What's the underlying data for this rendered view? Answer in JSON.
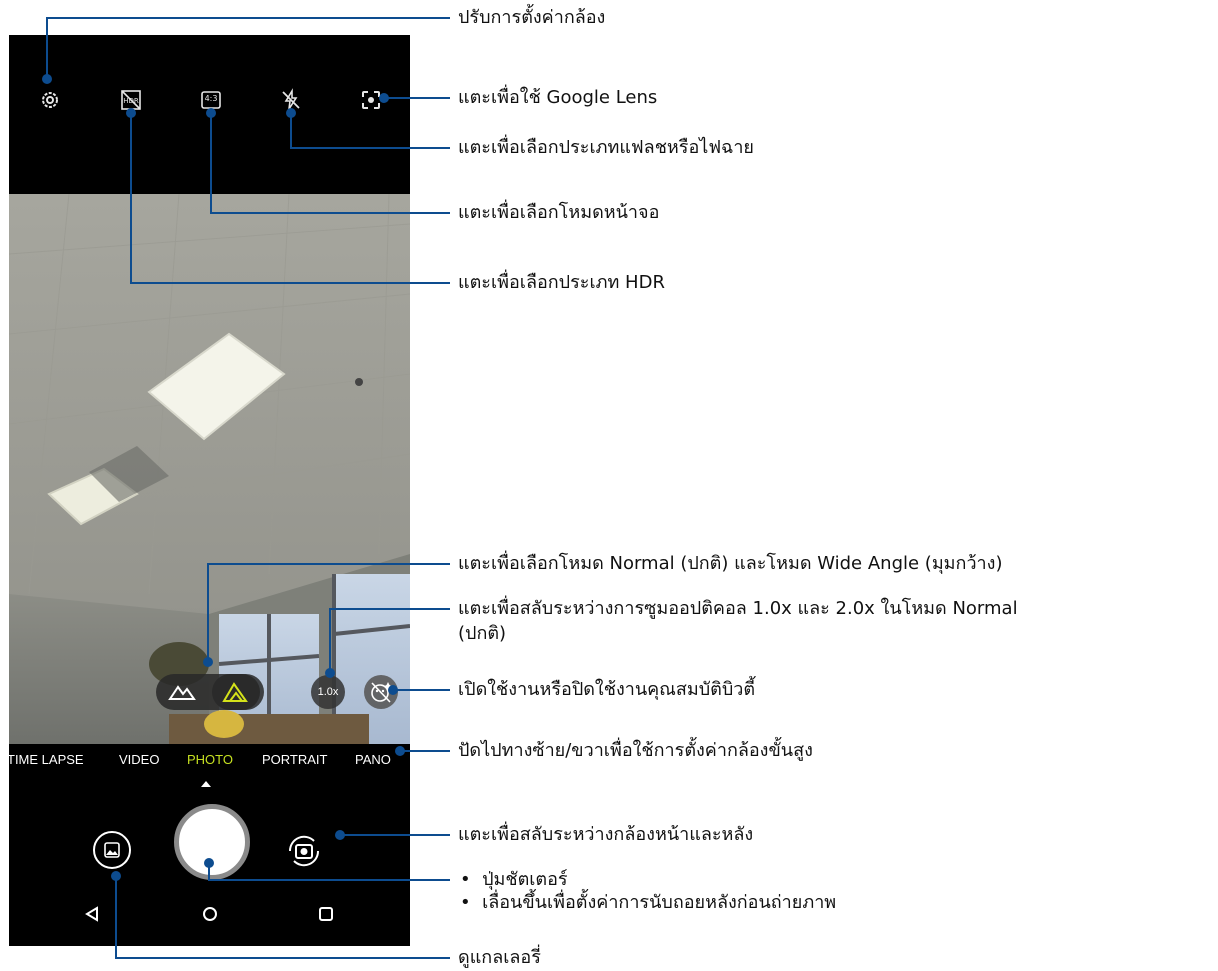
{
  "toolbar": {
    "icons": [
      "gear-icon",
      "hdr-off-icon",
      "aspect-ratio-icon",
      "flash-off-icon",
      "google-lens-icon"
    ],
    "aspect_label": "4:3"
  },
  "viewfinder": {
    "lens_buttons": [
      "normal-lens-icon",
      "wide-angle-lens-icon"
    ],
    "active_lens_color": "#d4e21a",
    "zoom_label": "1.0x",
    "beauty_icon": "beauty-off-icon"
  },
  "modes": {
    "items": [
      "TIME LAPSE",
      "VIDEO",
      "PHOTO",
      "PORTRAIT",
      "PANO"
    ],
    "active": "PHOTO",
    "active_color": "#c6e021"
  },
  "controls": {
    "gallery_icon": "gallery-icon",
    "shutter_icon": "shutter-button",
    "switch_icon": "switch-camera-icon"
  },
  "navbar": {
    "icons": [
      "back-icon",
      "home-icon",
      "recents-icon"
    ]
  },
  "callouts": {
    "settings": "ปรับการตั้งค่ากล้อง",
    "lens": "แตะเพื่อใช้ Google Lens",
    "flash": "แตะเพื่อเลือกประเภทแฟลชหรือไฟฉาย",
    "screen_mode": "แตะเพื่อเลือกโหมดหน้าจอ",
    "hdr": "แตะเพื่อเลือกประเภท HDR",
    "wide": "แตะเพื่อเลือกโหมด Normal (ปกติ) และโหมด Wide Angle (มุมกว้าง)",
    "zoom_line1": "แตะเพื่อสลับระหว่างการซูมออปติคอล 1.0x และ 2.0x ในโหมด Normal",
    "zoom_line2": "(ปกติ)",
    "beauty": "เปิดใช้งานหรือปิดใช้งานคุณสมบัติบิวตี้",
    "swipe": "ปัดไปทางซ้าย/ขวาเพื่อใช้การตั้งค่ากล้องขั้นสูง",
    "switch": "แตะเพื่อสลับระหว่างกล้องหน้าและหลัง",
    "shutter_bullets": [
      "ปุ่มชัตเตอร์",
      "เลื่อนขึ้นเพื่อตั้งค่าการนับถอยหลังก่อนถ่ายภาพ"
    ],
    "gallery": "ดูแกลเลอรี่"
  },
  "colors": {
    "callout_line": "#0d4c8f"
  }
}
